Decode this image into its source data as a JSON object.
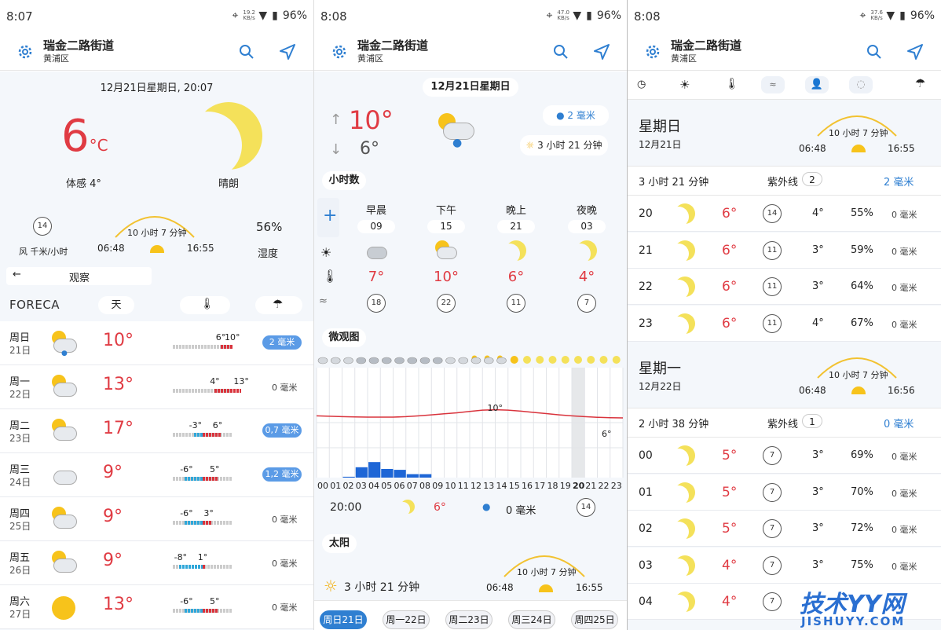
{
  "status": [
    {
      "time": "8:07",
      "speed": "19.2",
      "unit": "KB/s",
      "battery": "96%"
    },
    {
      "time": "8:08",
      "speed": "47.0",
      "unit": "KB/s",
      "battery": "96%"
    },
    {
      "time": "8:08",
      "speed": "37.6",
      "unit": "KB/s",
      "battery": "96%"
    }
  ],
  "header": {
    "city": "瑞金二路街道",
    "district": "黄浦区"
  },
  "p1": {
    "datetime": "12月21日星期日, 20:07",
    "temp": "6",
    "unit": "°C",
    "feels": "体感 4°",
    "condition": "晴朗",
    "wind_value": "14",
    "wind_label": "风 千米/小时",
    "daylight": "10 小时 7 分钟",
    "sunrise": "06:48",
    "sunset": "16:55",
    "humidity": "56%",
    "humidity_label": "湿度",
    "observe": "观察",
    "logo": "FORECA",
    "tab_day": "天",
    "days": [
      {
        "name": "周日",
        "date": "21日",
        "temp": "10°",
        "low": "6°",
        "high": "10°",
        "rain": "2 毫米",
        "badge": true
      },
      {
        "name": "周一",
        "date": "22日",
        "temp": "13°",
        "low": "4°",
        "high": "13°",
        "rain": "0 毫米",
        "badge": false
      },
      {
        "name": "周二",
        "date": "23日",
        "temp": "17°",
        "low": "-3°",
        "high": "6°",
        "rain": "0,7 毫米",
        "badge": true
      },
      {
        "name": "周三",
        "date": "24日",
        "temp": "9°",
        "low": "-6°",
        "high": "5°",
        "rain": "1,2 毫米",
        "badge": true
      },
      {
        "name": "周四",
        "date": "25日",
        "temp": "9°",
        "low": "-6°",
        "high": "3°",
        "rain": "0 毫米",
        "badge": false
      },
      {
        "name": "周五",
        "date": "26日",
        "temp": "9°",
        "low": "-8°",
        "high": "1°",
        "rain": "0 毫米",
        "badge": false
      },
      {
        "name": "周六",
        "date": "27日",
        "temp": "13°",
        "low": "-6°",
        "high": "5°",
        "rain": "0 毫米",
        "badge": false
      }
    ]
  },
  "p2": {
    "date": "12月21日星期日",
    "high": "10°",
    "low": "6°",
    "rain": "2 毫米",
    "sunshine": "3 小时 21 分钟",
    "hours_title": "小时数",
    "periods": [
      {
        "name": "早晨",
        "hour": "09",
        "temp": "7°",
        "wind": "18"
      },
      {
        "name": "下午",
        "hour": "15",
        "temp": "10°",
        "wind": "22"
      },
      {
        "name": "晚上",
        "hour": "21",
        "temp": "6°",
        "wind": "11"
      },
      {
        "name": "夜晚",
        "hour": "03",
        "temp": "4°",
        "wind": "7"
      }
    ],
    "micro_title": "微观图",
    "max_label": "10°",
    "end_label": "6°",
    "hours": [
      "00",
      "01",
      "02",
      "03",
      "04",
      "05",
      "06",
      "07",
      "08",
      "09",
      "10",
      "11",
      "12",
      "13",
      "14",
      "15",
      "16",
      "17",
      "18",
      "19",
      "20",
      "21",
      "22",
      "23"
    ],
    "sel_time": "20:00",
    "sel_temp": "6°",
    "sel_rain": "0 毫米",
    "sel_wind": "14",
    "sun_title": "太阳",
    "sun_hours": "3 小时 21 分钟",
    "daylight": "10 小时 7 分钟",
    "sunrise": "06:48",
    "sunset": "16:55",
    "tabs": [
      "周日21日",
      "周一22日",
      "周二23日",
      "周三24日",
      "周四25日"
    ]
  },
  "p3": {
    "d1": {
      "name": "星期日",
      "date": "12月21日",
      "daylight": "10 小时 7 分钟",
      "sunrise": "06:48",
      "sunset": "16:55",
      "sunshine": "3 小时 21 分钟",
      "uv": "紫外线",
      "uv_val": "2",
      "rain": "2 毫米"
    },
    "rows1": [
      {
        "h": "20",
        "t": "6°",
        "w": "14",
        "f": "4°",
        "hum": "55%",
        "r": "0 毫米"
      },
      {
        "h": "21",
        "t": "6°",
        "w": "11",
        "f": "3°",
        "hum": "59%",
        "r": "0 毫米"
      },
      {
        "h": "22",
        "t": "6°",
        "w": "11",
        "f": "3°",
        "hum": "64%",
        "r": "0 毫米"
      },
      {
        "h": "23",
        "t": "6°",
        "w": "11",
        "f": "4°",
        "hum": "67%",
        "r": "0 毫米"
      }
    ],
    "d2": {
      "name": "星期一",
      "date": "12月22日",
      "daylight": "10 小时 7 分钟",
      "sunrise": "06:48",
      "sunset": "16:56",
      "sunshine": "2 小时 38 分钟",
      "uv": "紫外线",
      "uv_val": "1",
      "rain": "0 毫米"
    },
    "rows2": [
      {
        "h": "00",
        "t": "5°",
        "w": "7",
        "f": "3°",
        "hum": "69%",
        "r": "0 毫米"
      },
      {
        "h": "01",
        "t": "5°",
        "w": "7",
        "f": "3°",
        "hum": "70%",
        "r": "0 毫米"
      },
      {
        "h": "02",
        "t": "5°",
        "w": "7",
        "f": "3°",
        "hum": "72%",
        "r": "0 毫米"
      },
      {
        "h": "03",
        "t": "4°",
        "w": "7",
        "f": "3°",
        "hum": "75%",
        "r": "0 毫米"
      },
      {
        "h": "04",
        "t": "4°",
        "w": "7",
        "f": "",
        "hum": "",
        "r": ""
      }
    ]
  },
  "watermark": {
    "main": "技术YY网",
    "sub": "JISHUYY.COM"
  }
}
